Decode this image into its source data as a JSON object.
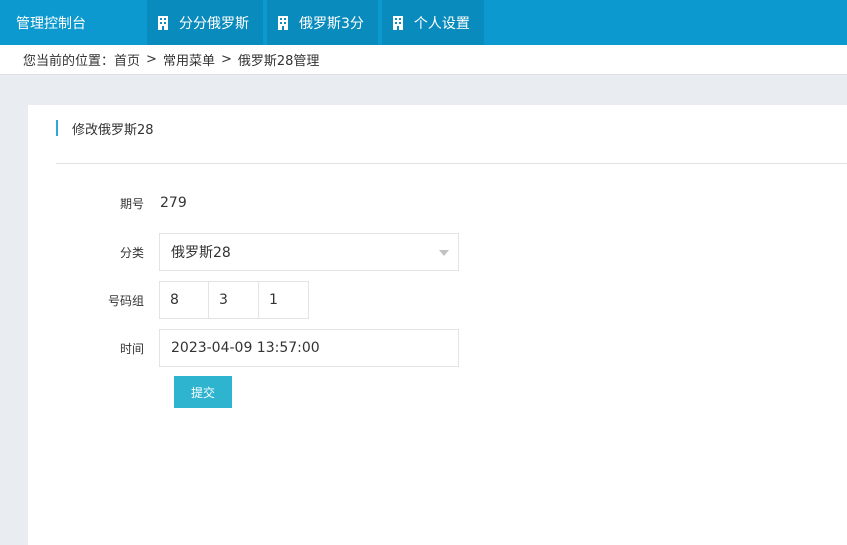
{
  "topbar": {
    "brand": "管理控制台",
    "nav": [
      {
        "label": "分分俄罗斯",
        "icon": "building-icon"
      },
      {
        "label": "俄罗斯3分",
        "icon": "building-icon"
      },
      {
        "label": "个人设置",
        "icon": "building-icon"
      }
    ]
  },
  "breadcrumb": {
    "prefix": "您当前的位置：",
    "items": [
      "首页",
      "常用菜单",
      "俄罗斯28管理"
    ],
    "separator": ">"
  },
  "panel": {
    "title": "修改俄罗斯28"
  },
  "form": {
    "issue_label": "期号",
    "issue_value": "279",
    "category_label": "分类",
    "category_value": "俄罗斯28",
    "numbers_label": "号码组",
    "numbers": [
      "8",
      "3",
      "1"
    ],
    "time_label": "时间",
    "time_value": "2023-04-09 13:57:00",
    "submit_label": "提交"
  },
  "colors": {
    "topbar": "#0c99cf",
    "nav_item": "#0a8bbd",
    "submit": "#2fb4d0",
    "accent": "#2fa9d6"
  }
}
